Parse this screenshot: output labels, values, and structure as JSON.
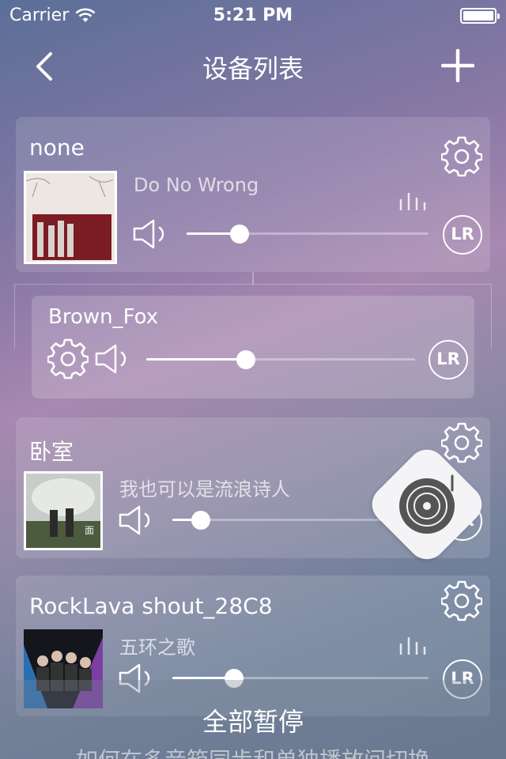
{
  "status_bar": {
    "carrier": "Carrier",
    "time": "5:21 PM"
  },
  "nav": {
    "title": "设备列表",
    "back_icon": "chevron-left-icon",
    "add_icon": "plus-icon"
  },
  "devices": [
    {
      "name": "none",
      "song": "Do No Wrong",
      "volume": 0.22,
      "channel": "LR",
      "playing": true
    },
    {
      "name": "Brown_Fox",
      "volume": 0.37,
      "channel": "LR"
    },
    {
      "name": "卧室",
      "song": "我也可以是流浪诗人",
      "volume": 0.11,
      "channel": "LR",
      "playing": false
    },
    {
      "name": "RockLava shout_28C8",
      "song": "五环之歌",
      "volume": 0.24,
      "channel": "LR",
      "playing": true
    }
  ],
  "footer": {
    "pause_all": "全部暂停",
    "help": "如何在多音箱同步和单独播放间切换"
  },
  "colors": {
    "accent": "#ffffff",
    "fab_bg": "#f4f4f6",
    "fab_icon": "#555555"
  }
}
